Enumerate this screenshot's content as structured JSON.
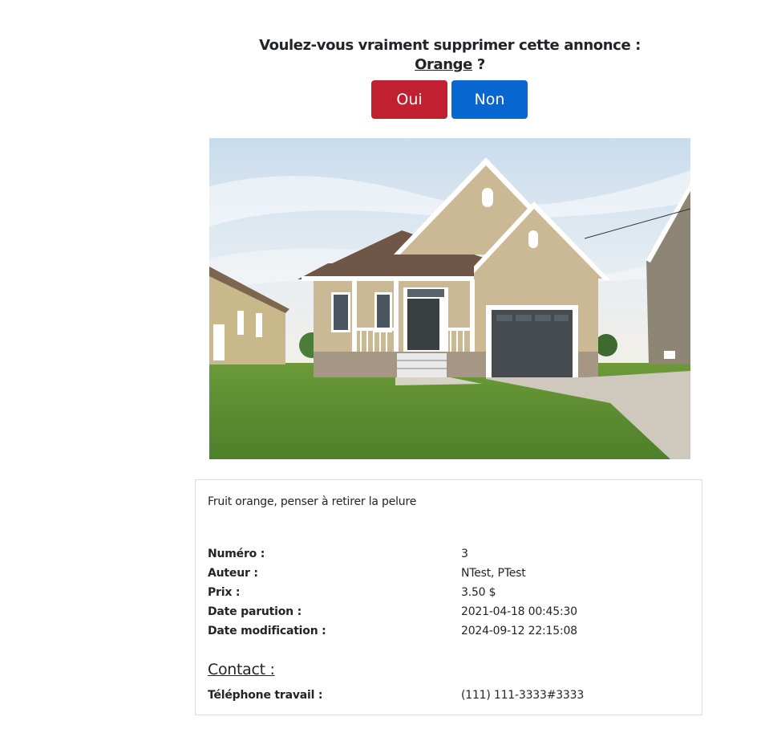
{
  "confirm": {
    "question": "Voulez-vous vraiment supprimer cette annonce :",
    "item_name": "Orange",
    "question_mark": " ?",
    "yes_label": "Oui",
    "no_label": "Non"
  },
  "listing": {
    "image_description": "photo of a beige house with grey garage door",
    "description": "Fruit orange, penser à retirer la pelure",
    "fields": [
      {
        "label": "Numéro :",
        "value": "3"
      },
      {
        "label": "Auteur :",
        "value": "NTest, PTest"
      },
      {
        "label": "Prix :",
        "value": "3.50 $"
      },
      {
        "label": "Date parution :",
        "value": "2021-04-18 00:45:30"
      },
      {
        "label": "Date modification :",
        "value": "2024-09-12 22:15:08"
      }
    ],
    "contact_heading": "Contact :",
    "contact_fields": [
      {
        "label": "Téléphone travail :",
        "value": "(111) 111-3333#3333"
      }
    ]
  },
  "colors": {
    "danger": "#c0202f",
    "primary": "#0866d1"
  }
}
